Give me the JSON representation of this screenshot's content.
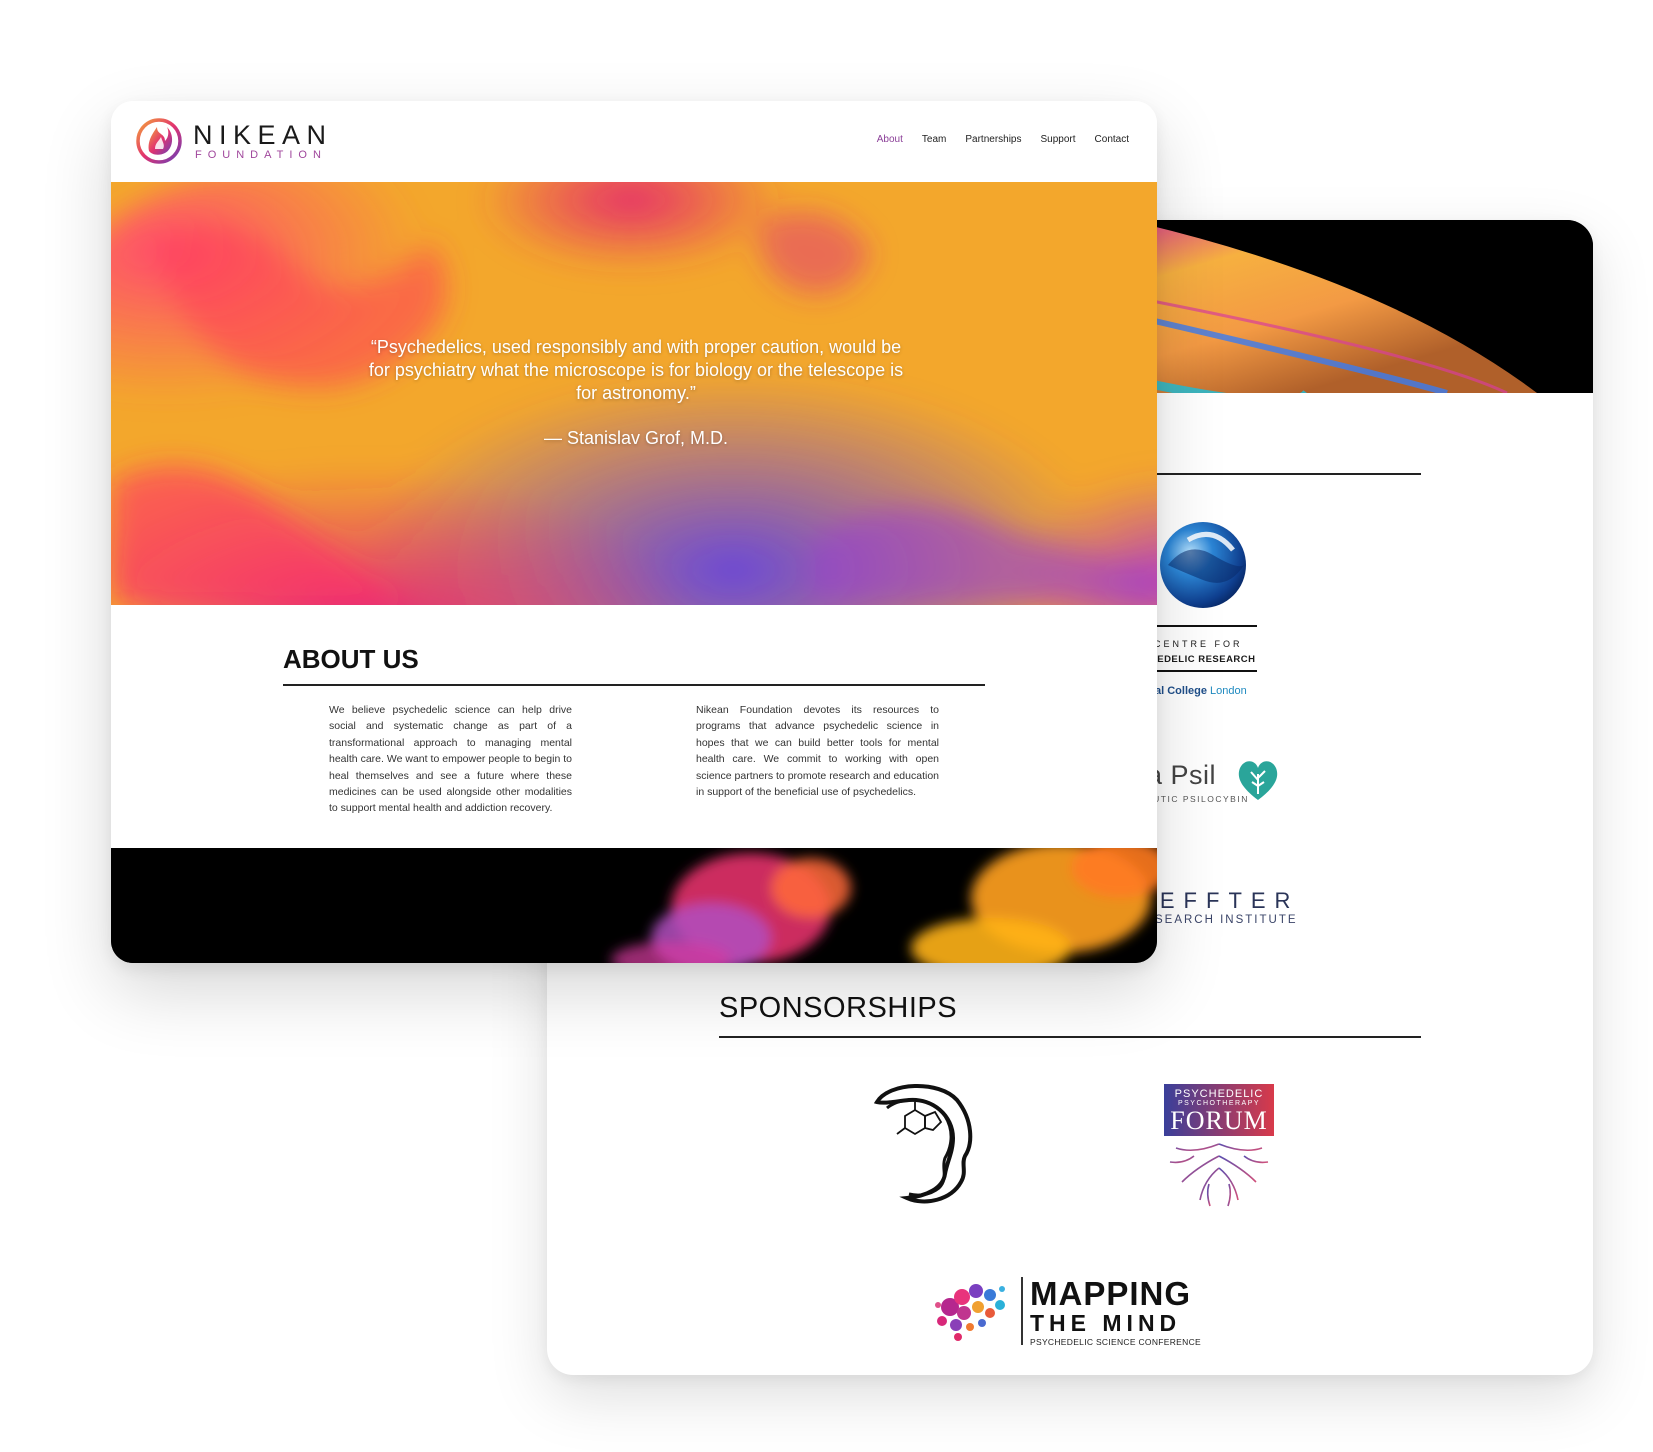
{
  "front_page": {
    "brand": {
      "name": "NIKEAN",
      "subtitle": "FOUNDATION"
    },
    "nav": {
      "items": [
        "About",
        "Team",
        "Partnerships",
        "Support",
        "Contact"
      ],
      "active": "About"
    },
    "hero": {
      "quote": "“Psychedelics, used responsibly and with proper caution, would be for psychiatry what the microscope is for biology or the telescope is for astronomy.”",
      "attribution": "— Stanislav Grof, M.D."
    },
    "about": {
      "heading": "ABOUT US",
      "column_left": "We believe psychedelic science can help drive social and systematic change as part of a transformational approach to managing mental health care. We want to empower people to begin to heal themselves and see a future where these medicines can be used alongside other modalities to support mental health and addiction recovery.",
      "column_right": "Nikean Foundation devotes its resources to programs that advance psychedelic science in hopes that we can build better tools for mental health care. We commit to working with open science partners to promote research and education in support of the beneficial use of psychedelics."
    }
  },
  "back_page": {
    "partners": {
      "centre_line_1": "HE CENTRE FOR",
      "centre_line_2": "PSYCHEDELIC RESEARCH",
      "imperial_bold": "Imperial College",
      "imperial_light": "London",
      "therapsil_name": "era Psil",
      "therapsil_tagline": "RAPEUTIC PSILOCYBIN",
      "heffter_name": "HEFFTER",
      "heffter_sub": "RESEARCH INSTITUTE"
    },
    "sponsorships": {
      "heading": "SPONSORSHIPS",
      "forum_line_1": "PSYCHEDELIC",
      "forum_line_2": "PSYCHOTHERAPY",
      "forum_line_3": "FORUM",
      "mapping_line_1": "MAPPING",
      "mapping_line_2": "THE MIND",
      "mapping_line_3": "PSYCHEDELIC SCIENCE CONFERENCE"
    }
  },
  "colors": {
    "accent_purple": "#8b3f98",
    "hero_orange": "#f3a72c",
    "hero_magenta": "#e8287a",
    "hero_violet": "#7b3fc0",
    "teal": "#2a9a9a",
    "imperial_blue": "#1f5fa0"
  },
  "icons": [
    "nikean-logo-icon",
    "centre-psychedelic-research-logo-icon",
    "therapsil-heart-icon",
    "molecule-head-icon",
    "forum-roots-icon",
    "mapping-mind-brain-icon"
  ]
}
